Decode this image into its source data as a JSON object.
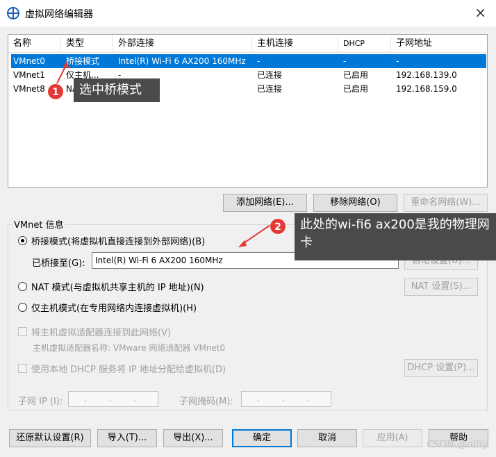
{
  "window": {
    "title": "虚拟网络编辑器",
    "close_icon": "×"
  },
  "table": {
    "headers": [
      "名称",
      "类型",
      "外部连接",
      "主机连接",
      "DHCP",
      "子网地址"
    ],
    "rows": [
      {
        "name": "VMnet0",
        "type": "桥接模式",
        "external": "Intel(R) Wi-Fi 6 AX200 160MHz",
        "host": "-",
        "dhcp": "-",
        "subnet": "-"
      },
      {
        "name": "VMnet1",
        "type": "仅主机...",
        "external": "-",
        "host": "已连接",
        "dhcp": "已启用",
        "subnet": "192.168.139.0"
      },
      {
        "name": "VMnet8",
        "type": "NAT 模式",
        "external": "NAT 模式",
        "host": "已连接",
        "dhcp": "已启用",
        "subnet": "192.168.159.0"
      }
    ]
  },
  "network_buttons": {
    "add": "添加网络(E)...",
    "remove": "移除网络(O)",
    "rename": "重命名网络(W)..."
  },
  "vmnet_info": {
    "title": "VMnet 信息",
    "bridge_radio": "桥接模式(将虚拟机直接连接到外部网络)(B)",
    "bridged_to_label": "已桥接至(G):",
    "bridged_to_value": "Intel(R) Wi-Fi 6 AX200 160MHz",
    "auto_settings": "自动设置(U)...",
    "nat_radio": "NAT 模式(与虚拟机共享主机的 IP 地址)(N)",
    "nat_settings": "NAT 设置(S)...",
    "host_only_radio": "仅主机模式(在专用网络内连接虚拟机)(H)",
    "connect_adapter": "将主机虚拟适配器连接到此网络(V)",
    "adapter_name": "主机虚拟适配器名称: VMware 网络适配器 VMnet0",
    "use_dhcp": "使用本地 DHCP 服务将 IP 地址分配给虚拟机(D)",
    "dhcp_settings": "DHCP 设置(P)...",
    "subnet_ip_label": "子网 IP (I):",
    "subnet_mask_label": "子网掩码(M):",
    "ip_placeholder": ". . ."
  },
  "footer": {
    "restore": "还原默认设置(R)",
    "import": "导入(T)...",
    "export": "导出(X)...",
    "ok": "确定",
    "cancel": "取消",
    "apply": "应用(A)",
    "help": "帮助"
  },
  "annotations": [
    {
      "number": "1",
      "text": "选中桥模式"
    },
    {
      "number": "2",
      "text": "此处的wi-fi6 ax200是我的物理网卡"
    }
  ],
  "watermark": "CSDN @alfiy",
  "colors": {
    "selection": "#0078d7",
    "annotation_badge": "#e53935",
    "annotation_box": "#4a4a4a"
  }
}
